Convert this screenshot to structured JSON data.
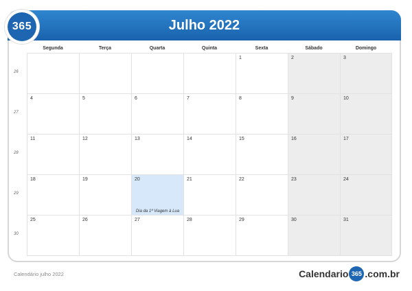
{
  "header": {
    "badge": "365",
    "title": "Julho 2022"
  },
  "days_of_week": [
    "Segunda",
    "Terça",
    "Quarta",
    "Quinta",
    "Sexta",
    "Sábado",
    "Domingo"
  ],
  "weeks": [
    {
      "week": "26",
      "days": [
        "",
        "",
        "",
        "",
        "1",
        "2",
        "3"
      ]
    },
    {
      "week": "27",
      "days": [
        "4",
        "5",
        "6",
        "7",
        "8",
        "9",
        "10"
      ]
    },
    {
      "week": "28",
      "days": [
        "11",
        "12",
        "13",
        "14",
        "15",
        "16",
        "17"
      ]
    },
    {
      "week": "29",
      "days": [
        "18",
        "19",
        "20",
        "21",
        "22",
        "23",
        "24"
      ]
    },
    {
      "week": "30",
      "days": [
        "25",
        "26",
        "27",
        "28",
        "29",
        "30",
        "31"
      ]
    }
  ],
  "events": {
    "20": "Dia da 1ª Viagem à Lua"
  },
  "highlight_color": "#d6e8f9",
  "accent_color": "#1e66b1",
  "watermark": "365",
  "footer": {
    "left": "Calendário julho 2022",
    "logo_pre": "Calendario",
    "logo_badge": "365",
    "logo_post": ".com.br"
  }
}
